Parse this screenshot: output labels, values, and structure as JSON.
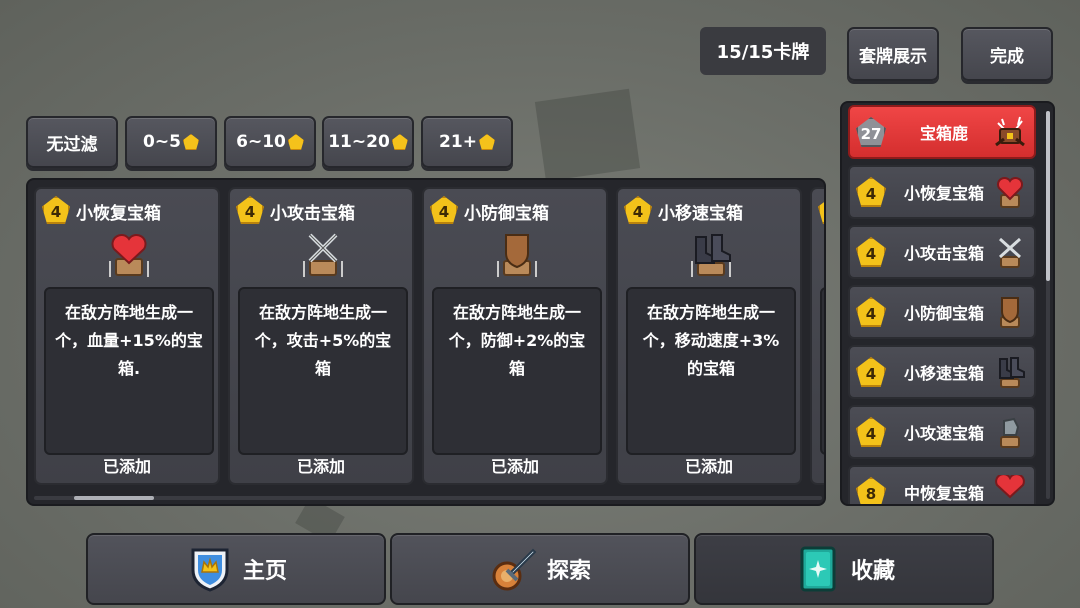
{
  "header": {
    "card_count": "15/15卡牌",
    "deck_display_label": "套牌展示",
    "done_label": "完成"
  },
  "filters": [
    {
      "label": "无过滤",
      "gem": false
    },
    {
      "label": "0~5",
      "gem": true
    },
    {
      "label": "6~10",
      "gem": true
    },
    {
      "label": "11~20",
      "gem": true
    },
    {
      "label": "21+",
      "gem": true
    }
  ],
  "cards": [
    {
      "cost": "4",
      "title": "小恢复宝箱",
      "desc": "在敌方阵地生成一个，血量+15%的宝箱.",
      "status": "已添加",
      "icon": "heart-chest-icon"
    },
    {
      "cost": "4",
      "title": "小攻击宝箱",
      "desc": "在敌方阵地生成一个，攻击+5%的宝箱",
      "status": "已添加",
      "icon": "swords-chest-icon"
    },
    {
      "cost": "4",
      "title": "小防御宝箱",
      "desc": "在敌方阵地生成一个，防御+2%的宝箱",
      "status": "已添加",
      "icon": "shield-chest-icon"
    },
    {
      "cost": "4",
      "title": "小移速宝箱",
      "desc": "在敌方阵地生成一个，移动速度+3%的宝箱",
      "status": "已添加",
      "icon": "boots-chest-icon"
    },
    {
      "cost": "4",
      "title": "",
      "desc": "",
      "status": "",
      "icon": ""
    }
  ],
  "deck": [
    {
      "cost": "27",
      "name": "宝箱鹿",
      "icon": "chest-deer-icon",
      "highlight": true
    },
    {
      "cost": "4",
      "name": "小恢复宝箱",
      "icon": "heart-chest-icon"
    },
    {
      "cost": "4",
      "name": "小攻击宝箱",
      "icon": "swords-chest-icon"
    },
    {
      "cost": "4",
      "name": "小防御宝箱",
      "icon": "shield-chest-icon"
    },
    {
      "cost": "4",
      "name": "小移速宝箱",
      "icon": "boots-chest-icon"
    },
    {
      "cost": "4",
      "name": "小攻速宝箱",
      "icon": "glove-chest-icon"
    },
    {
      "cost": "8",
      "name": "中恢复宝箱",
      "icon": "heart-chest-icon"
    }
  ],
  "nav": [
    {
      "label": "主页",
      "icon": "crown-shield-icon"
    },
    {
      "label": "探索",
      "icon": "sword-shield-icon"
    },
    {
      "label": "收藏",
      "icon": "book-icon",
      "active": true
    }
  ],
  "colors": {
    "accent_red": "#e63a3a",
    "gem_gold": "#f3c21a",
    "panel_dark": "#25262b"
  }
}
